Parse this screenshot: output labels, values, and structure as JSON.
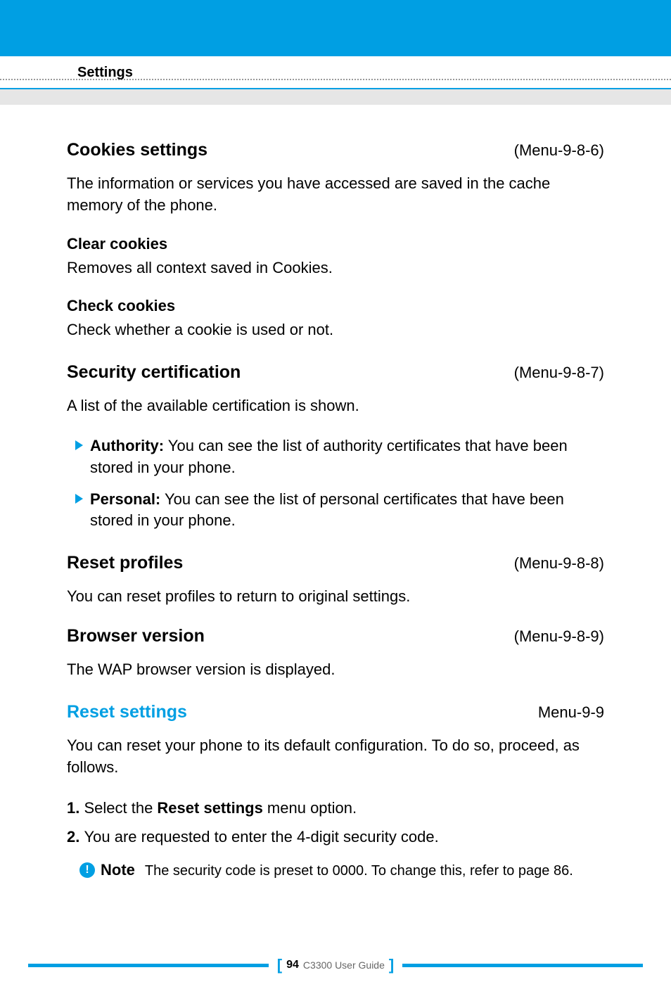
{
  "header": {
    "breadcrumb": "Settings"
  },
  "sections": {
    "cookies": {
      "title": "Cookies settings",
      "menu": "(Menu-9-8-6)",
      "intro": "The information or services you have accessed are saved in the cache memory of the phone.",
      "clear_heading": "Clear cookies",
      "clear_body": "Removes all context saved in Cookies.",
      "check_heading": "Check cookies",
      "check_body": "Check whether a cookie is used or not."
    },
    "security": {
      "title": "Security certification",
      "menu": "(Menu-9-8-7)",
      "intro": "A list of the available certification is shown.",
      "item1_label": "Authority:",
      "item1_body": " You can see the list of authority certificates that have been stored in your phone.",
      "item2_label": "Personal:",
      "item2_body": " You can see the list of personal certificates that have been stored in your phone."
    },
    "reset_profiles": {
      "title": "Reset profiles",
      "menu": "(Menu-9-8-8)",
      "body": "You can reset profiles to return to original settings."
    },
    "browser": {
      "title": "Browser version",
      "menu": "(Menu-9-8-9)",
      "body": "The WAP browser version is displayed."
    },
    "reset_settings": {
      "title": "Reset settings",
      "menu": "Menu-9-9",
      "intro": "You can reset your phone to its default configuration. To do so, proceed, as follows.",
      "step1_prefix": "1. ",
      "step1_a": "Select the ",
      "step1_bold": "Reset settings",
      "step1_b": " menu option.",
      "step2_prefix": "2. ",
      "step2_body": "You are requested to enter the 4-digit security code.",
      "note_icon": "!",
      "note_label": "Note",
      "note_body": "The security code is preset to 0000. To change this, refer to page 86."
    }
  },
  "footer": {
    "page": "94",
    "guide": "C3300 User Guide"
  }
}
